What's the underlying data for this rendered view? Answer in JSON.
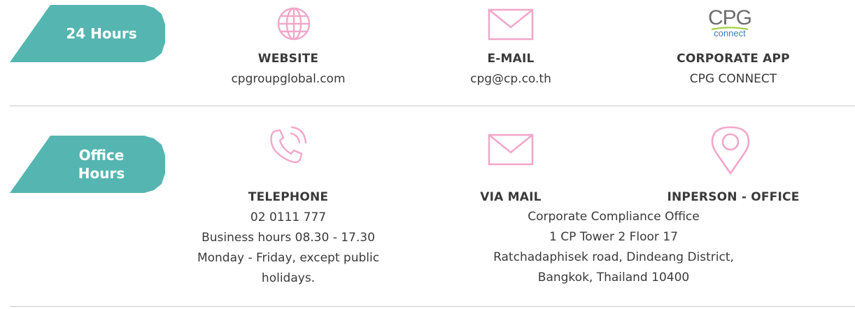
{
  "section1": {
    "tag": "24 Hours",
    "website": {
      "title": "WEBSITE",
      "value": "cpgroupglobal.com"
    },
    "email": {
      "title": "E-MAIL",
      "value": "cpg@cp.co.th"
    },
    "app": {
      "title": "CORPORATE APP",
      "value": "CPG CONNECT",
      "logo_big": "CPG",
      "logo_small": "connect"
    }
  },
  "section2": {
    "tag": "Office Hours",
    "telephone": {
      "title": "TELEPHONE",
      "number": "02 0111 777",
      "hours": "Business hours 08.30 - 17.30",
      "days": "Monday - Friday, except public",
      "days2": "holidays."
    },
    "mail": {
      "title": "VIA MAIL"
    },
    "inperson": {
      "title": "INPERSON - OFFICE"
    },
    "address": {
      "line1": "Corporate Compliance Office",
      "line2": "1 CP Tower 2 Floor 17",
      "line3": "Ratchadaphisek road, Dindeang District,",
      "line4": "Bangkok, Thailand 10400"
    }
  },
  "colors": {
    "teal": "#55b6b1",
    "pink": "#f2a7c9",
    "text": "#3a3a3a"
  }
}
